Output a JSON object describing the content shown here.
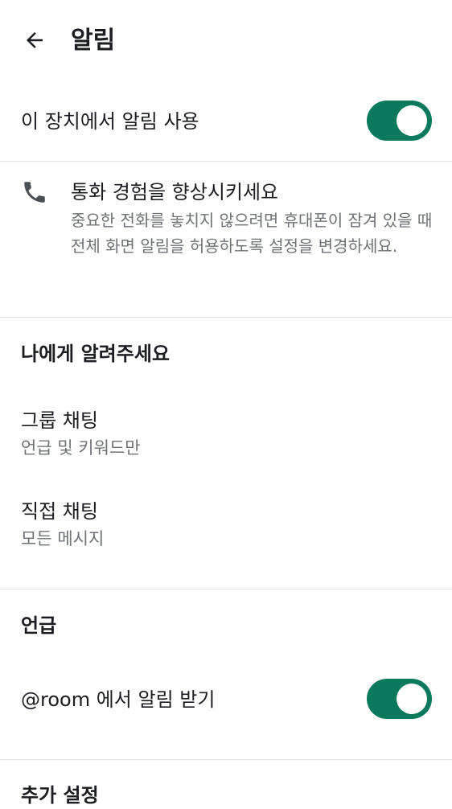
{
  "header": {
    "title": "알림"
  },
  "device_notifications": {
    "label": "이 장치에서 알림 사용",
    "enabled": true
  },
  "call_banner": {
    "title": "통화 경험을 향상시키세요",
    "description": "중요한 전화를 놓치지 않으려면 휴대폰이 잠겨 있을 때 전체 화면 알림을 허용하도록 설정을 변경하세요."
  },
  "notify_me": {
    "header": "나에게 알려주세요",
    "items": [
      {
        "title": "그룹 채팅",
        "value": "언급 및 키워드만"
      },
      {
        "title": "직접 채팅",
        "value": "모든 메시지"
      }
    ]
  },
  "mentions": {
    "header": "언급",
    "room_label": "@room 에서 알림 받기",
    "room_enabled": true
  },
  "additional": {
    "header": "추가 설정"
  },
  "colors": {
    "toggle_on": "#0b7a5c",
    "divider": "#e3e5e8",
    "secondary_text": "#6e7277"
  }
}
